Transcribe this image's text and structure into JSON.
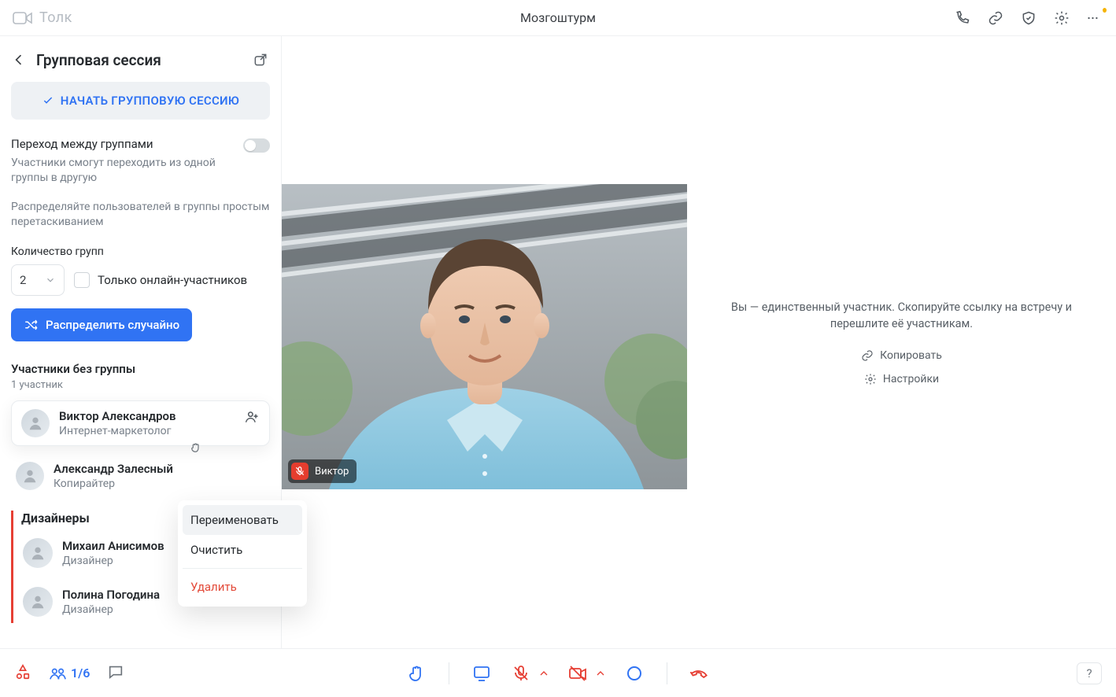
{
  "brand": "Толк",
  "meeting_title": "Мозгоштурм",
  "sidebar": {
    "title": "Групповая сессия",
    "start_label": "НАЧАТЬ ГРУППОВУЮ СЕССИЮ",
    "switch": {
      "title": "Переход между группами",
      "desc": "Участники смогут переходить из одной группы в другую"
    },
    "drag_hint": "Распределяйте пользователей в группы простым перетаскиванием",
    "count_label": "Количество групп",
    "count_value": "2",
    "only_online_label": "Только онлайн-участников",
    "distribute_label": "Распределить случайно",
    "no_group": {
      "title": "Участники без группы",
      "subtitle": "1 участник"
    },
    "users_no_group": [
      {
        "name": "Виктор Александров",
        "role": "Интернет-маркетолог"
      },
      {
        "name": "Александр Залесный",
        "role": "Копирайтер"
      }
    ],
    "group": {
      "title": "Дизайнеры",
      "members": [
        {
          "name": "Михаил Анисимов",
          "role": "Дизайнер"
        },
        {
          "name": "Полина Погодина",
          "role": "Дизайнер"
        }
      ]
    },
    "menu": {
      "rename": "Переименовать",
      "clear": "Очистить",
      "delete": "Удалить"
    }
  },
  "stage": {
    "participant_label": "Виктор",
    "info_line": "Вы — единственный участник. Скопируйте ссылку на встречу и перешлите её участникам.",
    "copy_label": "Копировать",
    "settings_label": "Настройки"
  },
  "bottombar": {
    "count": "1/6",
    "help": "?"
  }
}
